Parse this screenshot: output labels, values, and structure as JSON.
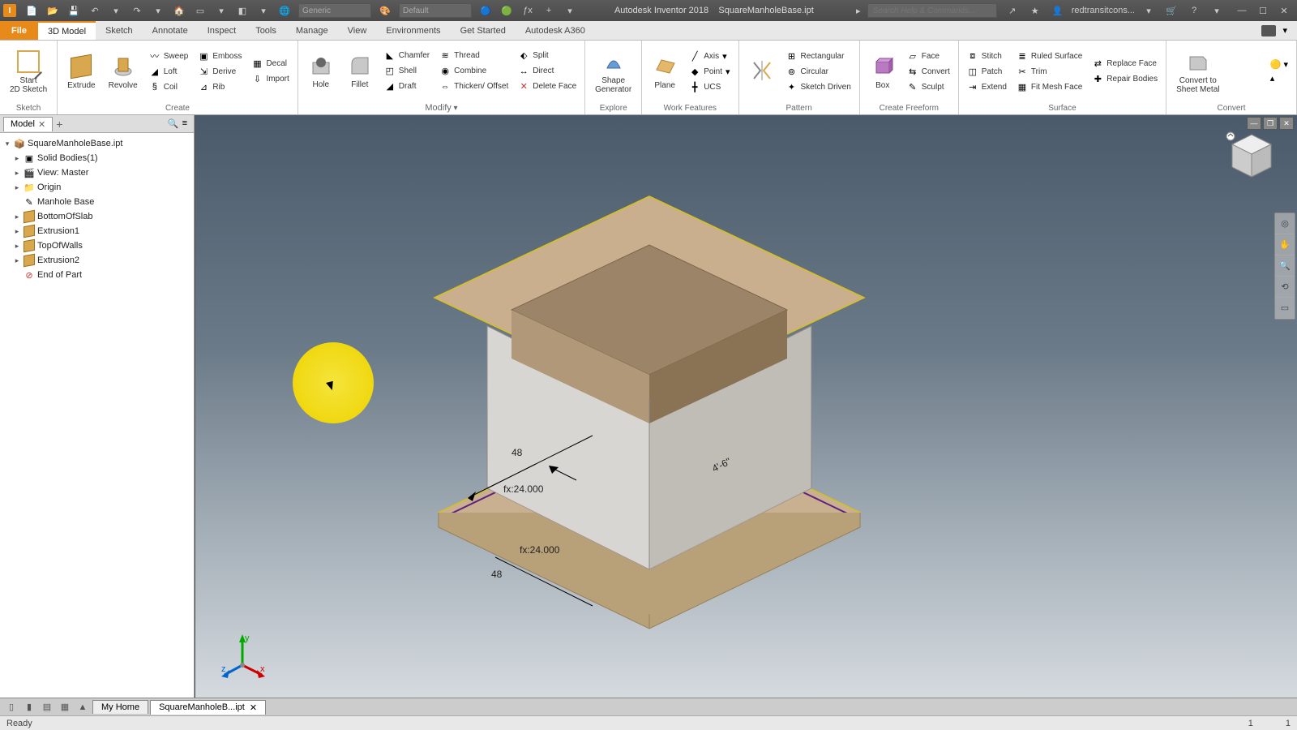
{
  "title": {
    "app": "Autodesk Inventor 2018",
    "doc": "SquareManholeBase.ipt"
  },
  "qat_material": "Generic",
  "qat_appearance": "Default",
  "search_placeholder": "Search Help & Commands...",
  "user": "redtransitcons...",
  "menus": {
    "file": "File",
    "tabs": [
      "3D Model",
      "Sketch",
      "Annotate",
      "Inspect",
      "Tools",
      "Manage",
      "View",
      "Environments",
      "Get Started",
      "Autodesk A360"
    ],
    "active": "3D Model"
  },
  "ribbon": {
    "sketch": {
      "start": "Start\n2D Sketch",
      "panel": "Sketch"
    },
    "create": {
      "extrude": "Extrude",
      "revolve": "Revolve",
      "sweep": "Sweep",
      "loft": "Loft",
      "coil": "Coil",
      "emboss": "Emboss",
      "derive": "Derive",
      "rib": "Rib",
      "decal": "Decal",
      "import": "Import",
      "panel": "Create"
    },
    "modify": {
      "hole": "Hole",
      "fillet": "Fillet",
      "chamfer": "Chamfer",
      "shell": "Shell",
      "draft": "Draft",
      "thread": "Thread",
      "combine": "Combine",
      "thicken": "Thicken/ Offset",
      "split": "Split",
      "direct": "Direct",
      "delface": "Delete Face",
      "panel": "Modify"
    },
    "explore": {
      "shape": "Shape\nGenerator",
      "panel": "Explore"
    },
    "work": {
      "plane": "Plane",
      "axis": "Axis",
      "point": "Point",
      "ucs": "UCS",
      "panel": "Work Features"
    },
    "pattern": {
      "rect": "Rectangular",
      "circ": "Circular",
      "sketchdriven": "Sketch Driven",
      "panel": "Pattern"
    },
    "freeform": {
      "box": "Box",
      "face": "Face",
      "convert": "Convert",
      "sculpt": "Sculpt",
      "panel": "Create Freeform"
    },
    "surface": {
      "stitch": "Stitch",
      "patch": "Patch",
      "extend": "Extend",
      "ruled": "Ruled Surface",
      "trim": "Trim",
      "fitmesh": "Fit Mesh Face",
      "replace": "Replace Face",
      "repair": "Repair Bodies",
      "panel": "Surface"
    },
    "convert": {
      "sheetmetal": "Convert to\nSheet Metal",
      "panel": "Convert"
    }
  },
  "browser": {
    "tab": "Model",
    "root": "SquareManholeBase.ipt",
    "nodes": [
      {
        "icon": "bodies",
        "label": "Solid Bodies(1)",
        "expand": "▸"
      },
      {
        "icon": "view",
        "label": "View: Master",
        "expand": "▸"
      },
      {
        "icon": "folder",
        "label": "Origin",
        "expand": "▸"
      },
      {
        "icon": "sketch",
        "label": "Manhole Base",
        "expand": ""
      },
      {
        "icon": "extrude",
        "label": "BottomOfSlab",
        "expand": "▸"
      },
      {
        "icon": "extrude",
        "label": "Extrusion1",
        "expand": "▸"
      },
      {
        "icon": "extrude",
        "label": "TopOfWalls",
        "expand": "▸"
      },
      {
        "icon": "extrude",
        "label": "Extrusion2",
        "expand": "▸"
      },
      {
        "icon": "end",
        "label": "End of Part",
        "expand": ""
      }
    ]
  },
  "dims": {
    "d1": "48",
    "d2": "48",
    "d3": "fx:24.000",
    "d4": "fx:24.000",
    "d5": "4'-6\""
  },
  "doc_tabs": {
    "home": "My Home",
    "doc": "SquareManholeB...ipt"
  },
  "status": {
    "msg": "Ready",
    "c1": "1",
    "c2": "1"
  }
}
